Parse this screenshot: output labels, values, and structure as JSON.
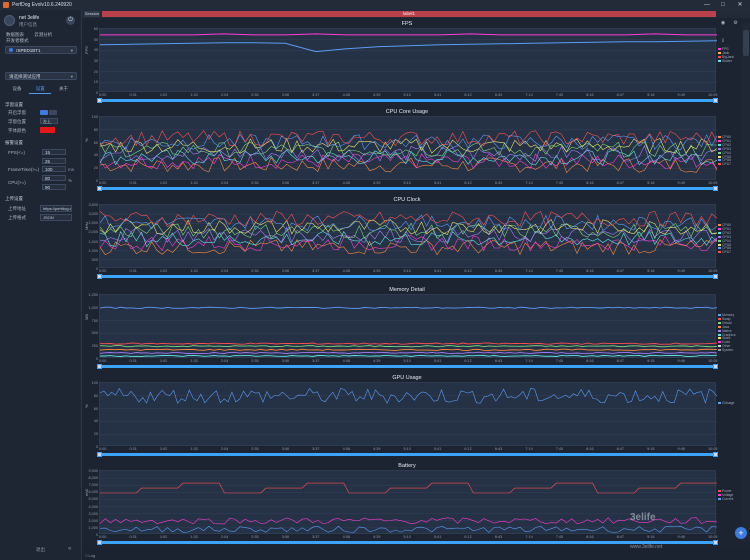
{
  "window": {
    "title": "PerfDog Evolv10.6.240920",
    "minimize": "—",
    "maximize": "□",
    "close": "✕"
  },
  "user": {
    "name": "net 3elife",
    "sub": "用户信息"
  },
  "nav": {
    "items": [
      "数据图表",
      "云测分析",
      "开发者模式"
    ]
  },
  "device": {
    "name": "ISPED1BT1"
  },
  "sidebar": {
    "app_placeholder": "请选择测试应用",
    "tabs": [
      "设备",
      "设置",
      "关于"
    ],
    "float_section": "浮窗设置",
    "float_rows": [
      {
        "label": "开启浮窗"
      },
      {
        "label": "浮窗位置",
        "value": "左上"
      },
      {
        "label": "字体颜色"
      }
    ],
    "alert_section": "报警设置",
    "alert_rows": [
      {
        "label": "FPS(<=)",
        "value": "15"
      },
      {
        "label": "",
        "value": "25"
      },
      {
        "label": "FrameTime(>=)",
        "value": "100",
        "unit": "ms"
      },
      {
        "label": "CPU(>=)",
        "value": "80",
        "unit": "%"
      },
      {
        "label": "",
        "value": "90"
      }
    ],
    "upload_section": "上传设置",
    "upload_rows": [
      {
        "label": "上传地址",
        "value": "https://perfdog.q"
      },
      {
        "label": "上传格式",
        "value": "JSON"
      }
    ],
    "logout": "退出"
  },
  "main": {
    "session_tab": "Session",
    "label_bar": "label1"
  },
  "x_ticks": [
    "0:00",
    "0:31",
    "1:02",
    "1:33",
    "2:04",
    "2:35",
    "3:06",
    "3:37",
    "4:08",
    "4:39",
    "5:10",
    "5:41",
    "6:12",
    "6:43",
    "7:14",
    "7:45",
    "8:16",
    "8:47",
    "9:18",
    "9:49",
    "10:05"
  ],
  "chart_data": [
    {
      "type": "line",
      "title": "FPS",
      "ylabel": "FPS",
      "yticks": [
        "60",
        "50",
        "40",
        "30",
        "20",
        "10",
        "0"
      ],
      "ylim": [
        0,
        65
      ],
      "legend_right": [
        "FPS",
        "Jank",
        "BigJank",
        "Stutter"
      ],
      "legend_colors": [
        "#ff3cd6",
        "#ffb347",
        "#ff5050",
        "#5ee3e3"
      ],
      "series": [
        {
          "name": "FPS",
          "color": "#ff3cd6",
          "values": [
            59,
            59,
            59,
            59,
            60,
            59,
            59,
            60,
            59,
            59,
            59,
            59,
            60,
            59,
            59,
            59,
            59,
            59,
            60,
            59,
            59
          ]
        },
        {
          "name": "",
          "color": "#5b9cf7",
          "values": [
            49,
            49.5,
            50,
            50.5,
            51,
            51,
            50.5,
            42,
            45,
            47,
            48,
            49,
            49.5,
            50,
            50.5,
            51,
            51.5,
            52,
            52,
            52.5,
            53
          ]
        }
      ]
    },
    {
      "type": "line",
      "title": "CPU Core Usage",
      "ylabel": "%",
      "yticks": [
        "100",
        "80",
        "60",
        "40",
        "20",
        "0"
      ],
      "ylim": [
        0,
        100
      ],
      "legend_right": [
        "CPU0",
        "CPU1",
        "CPU2",
        "CPU3",
        "CPU4",
        "CPU5",
        "CPU6",
        "CPU7"
      ],
      "legend_colors": [
        "#ff8a3c",
        "#ff3cd6",
        "#5ee3e3",
        "#a27cf7",
        "#7bd67b",
        "#e9e46a",
        "#5b9cf7",
        "#ff5050"
      ]
    },
    {
      "type": "line",
      "title": "CPU Clock",
      "ylabel": "MHz",
      "yticks": [
        "3,500",
        "3,000",
        "2,500",
        "2,000",
        "1,500",
        "1,000",
        "500",
        "0"
      ],
      "ylim": [
        0,
        3500
      ],
      "legend_right": [
        "CPU0",
        "CPU1",
        "CPU2",
        "CPU3",
        "CPU4",
        "CPU5",
        "CPU6",
        "CPU7"
      ],
      "legend_colors": [
        "#ff8a3c",
        "#ff3cd6",
        "#5ee3e3",
        "#a27cf7",
        "#7bd67b",
        "#e9e46a",
        "#5b9cf7",
        "#ff5050"
      ]
    },
    {
      "type": "line",
      "title": "Memory Detail",
      "ylabel": "MB",
      "yticks": [
        "1,250",
        "1,000",
        "750",
        "500",
        "250",
        "0"
      ],
      "ylim": [
        0,
        1250
      ],
      "legend_right": [
        "Memory",
        "Swap",
        "Virtual",
        "Java",
        "Native",
        "Graphics",
        "Stack",
        "Code",
        "Other",
        "System"
      ],
      "legend_colors": [
        "#5b9cf7",
        "#ff5050",
        "#7bd67b",
        "#ff8a3c",
        "#a27cf7",
        "#5ee3e3",
        "#e9e46a",
        "#ff3cd6",
        "#cfd6df",
        "#8d99aa"
      ]
    },
    {
      "type": "line",
      "title": "GPU Usage",
      "ylabel": "%",
      "yticks": [
        "100",
        "80",
        "60",
        "40",
        "20",
        "0"
      ],
      "ylim": [
        0,
        100
      ],
      "legend_right": [
        "GUsage"
      ],
      "legend_colors": [
        "#5b9cf7"
      ]
    },
    {
      "type": "line",
      "title": "Battery",
      "ylabel": "mW",
      "yticks": [
        "9,000",
        "8,000",
        "7,000",
        "6,000",
        "5,000",
        "4,000",
        "3,000",
        "2,000",
        "1,000",
        "0"
      ],
      "ylim": [
        0,
        9000
      ],
      "legend_right": [
        "Power",
        "Voltage",
        "Current"
      ],
      "legend_colors": [
        "#ff5050",
        "#ff3cd6",
        "#5b9cf7"
      ]
    }
  ],
  "watermark": {
    "text": "3elife",
    "sub": "www.3elife.net"
  },
  "bottom": {
    "left": "□ Log"
  }
}
